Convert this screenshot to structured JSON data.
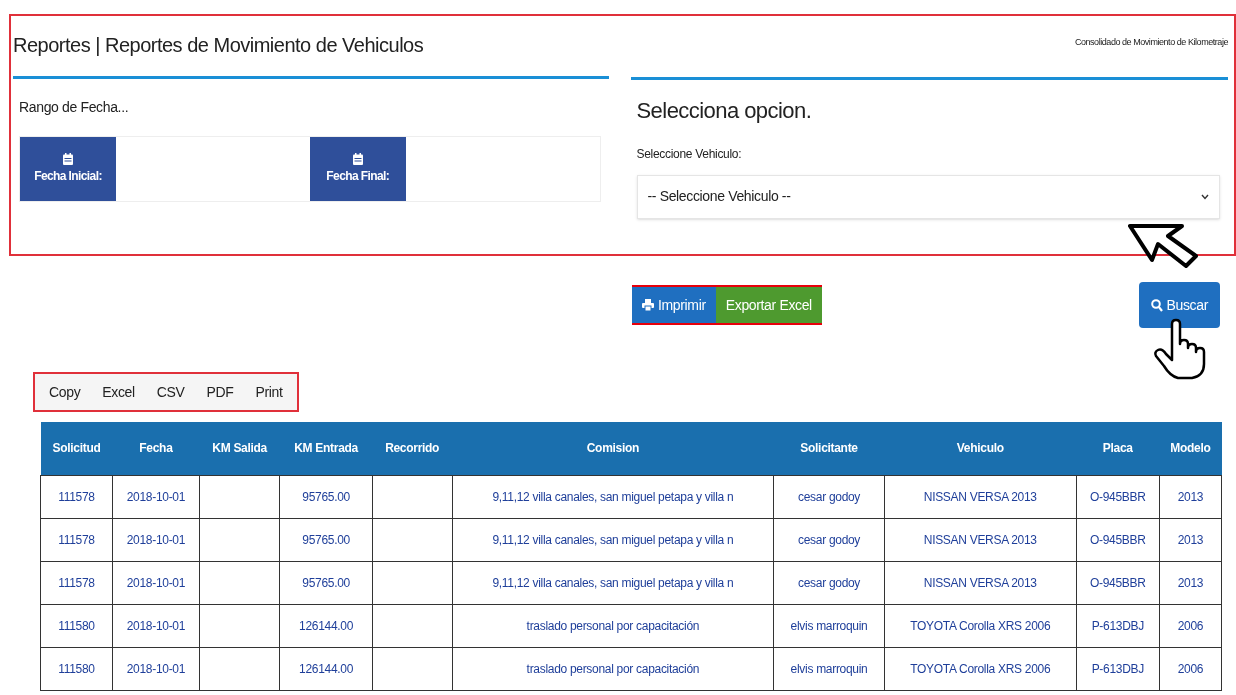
{
  "header": {
    "title": "Reportes | Reportes de Movimiento de Vehiculos",
    "subtitle": "Consolidado de Movimiento de Kilometraje"
  },
  "date_range": {
    "label": "Rango de Fecha...",
    "fields": [
      {
        "label": "Fecha Inicial:"
      },
      {
        "label": "Fecha Final:"
      }
    ]
  },
  "vehicle": {
    "heading": "Selecciona opcion.",
    "label": "Seleccione Vehiculo:",
    "select_value": "-- Seleccione Vehiculo --"
  },
  "actions": [
    {
      "label": "Imprimir",
      "kind": "print"
    },
    {
      "label": "Exportar Excel",
      "kind": "excel"
    }
  ],
  "search_button": "Buscar",
  "export_buttons": [
    "Copy",
    "Excel",
    "CSV",
    "PDF",
    "Print"
  ],
  "table": {
    "columns": [
      "Solicitud",
      "Fecha",
      "KM Salida",
      "KM Entrada",
      "Recorrido",
      "Comision",
      "Solicitante",
      "Vehiculo",
      "Placa",
      "Modelo"
    ],
    "rows": [
      [
        "111578",
        "2018-10-01",
        null,
        "95765.00",
        null,
        "9,11,12 villa canales, san miguel petapa y villa n",
        "cesar godoy",
        "NISSAN VERSA 2013",
        "O-945BBR",
        "2013"
      ],
      [
        "111578",
        "2018-10-01",
        null,
        "95765.00",
        null,
        "9,11,12 villa canales, san miguel petapa y villa n",
        "cesar godoy",
        "NISSAN VERSA 2013",
        "O-945BBR",
        "2013"
      ],
      [
        "111578",
        "2018-10-01",
        null,
        "95765.00",
        null,
        "9,11,12 villa canales, san miguel petapa y villa n",
        "cesar godoy",
        "NISSAN VERSA 2013",
        "O-945BBR",
        "2013"
      ],
      [
        "111580",
        "2018-10-01",
        null,
        "126144.00",
        null,
        "traslado personal por capacitación",
        "elvis marroquin",
        "TOYOTA Corolla XRS 2006",
        "P-613DBJ",
        "2006"
      ],
      [
        "111580",
        "2018-10-01",
        null,
        "126144.00",
        null,
        "traslado personal por capacitación",
        "elvis marroquin",
        "TOYOTA Corolla XRS 2006",
        "P-613DBJ",
        "2006"
      ]
    ]
  }
}
